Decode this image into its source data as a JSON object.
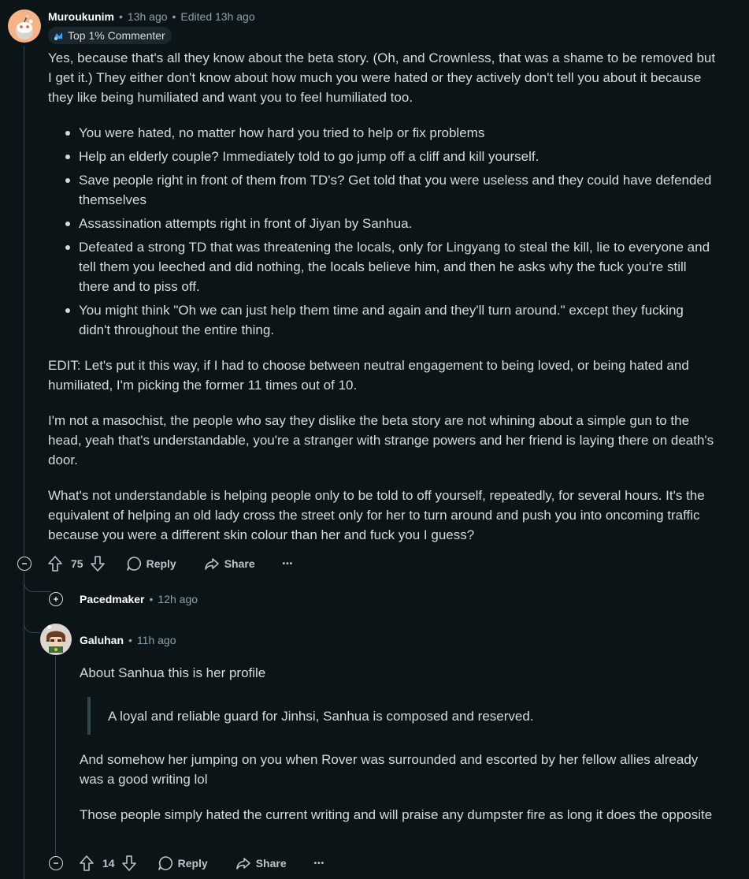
{
  "comment1": {
    "author": "Muroukunim",
    "time": "13h ago",
    "edited": "Edited 13h ago",
    "badge": "Top 1% Commenter",
    "paragraphs": [
      "Yes, because that's all they know about the beta story. (Oh, and Crownless, that was a shame to be removed but I get it.) They either don't know about how much you were hated or they actively don't tell you about it because they like being humiliated and want you to feel humiliated too."
    ],
    "bullets": [
      "You were hated, no matter how hard you tried to help or fix problems",
      "Help an elderly couple? Immediately told to go jump off a cliff and kill yourself.",
      "Save people right in front of them from TD's? Get told that you were useless and they could have defended themselves",
      "Assassination attempts right in front of Jiyan by Sanhua.",
      "Defeated a strong TD that was threatening the locals, only for Lingyang to steal the kill, lie to everyone and tell them you leeched and did nothing, the locals believe him, and then he asks why the fuck you're still there and to piss off.",
      "You might think \"Oh we can just help them time and again and they'll turn around.\" except they fucking didn't throughout the entire thing."
    ],
    "edit_paragraphs": [
      "EDIT: Let's put it this way, if I had to choose between neutral engagement to being loved, or being hated and humiliated, I'm picking the former 11 times out of 10.",
      "I'm not a masochist, the people who say they dislike the beta story are not whining about a simple gun to the head, yeah that's understandable, you're a stranger with strange powers and her friend is laying there on death's door.",
      "What's not understandable is helping people only to be told to off yourself, repeatedly, for several hours. It's the equivalent of helping an old lady cross the street only for her to turn around and push you into oncoming traffic because you were a different skin colour than her and fuck you I guess?"
    ],
    "votes": "75",
    "reply_label": "Reply",
    "share_label": "Share",
    "more_label": "•••"
  },
  "collapsed_reply": {
    "author": "Pacedmaker",
    "time": "12h ago"
  },
  "comment2": {
    "author": "Galuhan",
    "time": "11h ago",
    "intro": "About Sanhua this is her profile",
    "quote": "A loyal and reliable guard for Jinhsi, Sanhua is composed and reserved.",
    "paragraphs": [
      "And somehow her jumping on you when Rover was surrounded and escorted by her fellow allies already was a good writing lol",
      "Those people simply hated the current writing and will praise any dumpster fire as long it does the opposite"
    ],
    "votes": "14",
    "reply_label": "Reply",
    "share_label": "Share",
    "more_label": "•••"
  },
  "separator": "•",
  "colors": {
    "background": "#0b1416",
    "text": "#d7dadc",
    "meta": "#8ba2ad",
    "thread_line": "#33464c"
  }
}
